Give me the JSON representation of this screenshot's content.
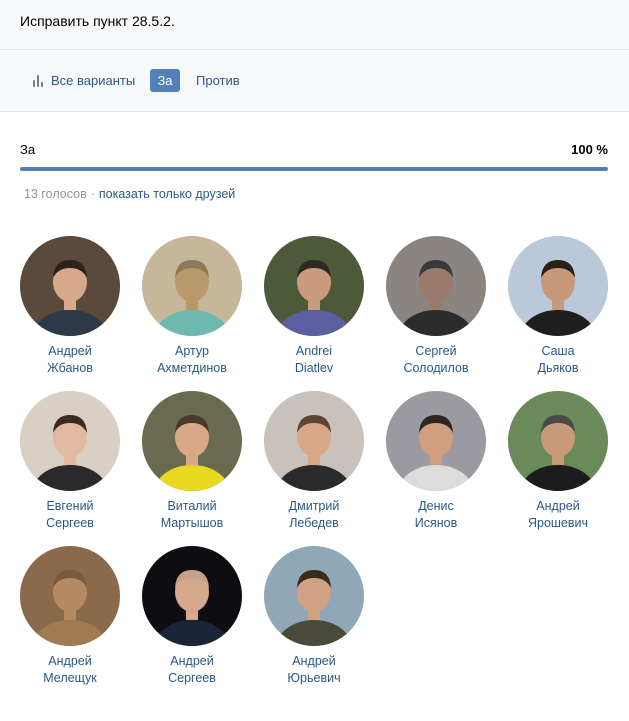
{
  "header": {
    "title": "Исправить пункт 28.5.2."
  },
  "tabs": {
    "all_label": "Все варианты",
    "for_label": "За",
    "against_label": "Против"
  },
  "result": {
    "label": "За",
    "percent_text": "100 %",
    "percent": 100
  },
  "meta": {
    "votes_count": "13 голосов",
    "separator": "·",
    "friends_link": "показать только друзей"
  },
  "colors": {
    "accent": "#5181b8",
    "link": "#2a5885",
    "muted": "#939393"
  },
  "voters": [
    {
      "first": "Андрей",
      "last": "Жбанов",
      "avatar_bg": "#5a4a3c",
      "skin": "#d8a88a",
      "cloth": "#2d3a4a",
      "hair": "#2b221c"
    },
    {
      "first": "Артур",
      "last": "Ахметдинов",
      "avatar_bg": "#c7b79a",
      "skin": "#b89a6a",
      "cloth": "#6fb8b0",
      "hair": "#8a7a5a"
    },
    {
      "first": "Andrei",
      "last": "Diatlev",
      "avatar_bg": "#4d5a3a",
      "skin": "#c99a7c",
      "cloth": "#5a5fa0",
      "hair": "#2e2a22"
    },
    {
      "first": "Сергей",
      "last": "Солодилов",
      "avatar_bg": "#8a8580",
      "skin": "#9a7a6a",
      "cloth": "#2c2c2c",
      "hair": "#3a3a3a"
    },
    {
      "first": "Саша",
      "last": "Дьяков",
      "avatar_bg": "#b9c9d9",
      "skin": "#c7987a",
      "cloth": "#1e1e1e",
      "hair": "#2a2018"
    },
    {
      "first": "Евгений",
      "last": "Сергеев",
      "avatar_bg": "#d9cfc2",
      "skin": "#e0b9a0",
      "cloth": "#2a2a2a",
      "hair": "#3a2a20"
    },
    {
      "first": "Виталий",
      "last": "Мартышов",
      "avatar_bg": "#6a6a50",
      "skin": "#d9a889",
      "cloth": "#e8d820",
      "hair": "#4a3a2a"
    },
    {
      "first": "Дмитрий",
      "last": "Лебедев",
      "avatar_bg": "#c9c2bc",
      "skin": "#d8a788",
      "cloth": "#2a2a2a",
      "hair": "#5a4432"
    },
    {
      "first": "Денис",
      "last": "Исянов",
      "avatar_bg": "#9a9aa0",
      "skin": "#d19e80",
      "cloth": "#dcdcdc",
      "hair": "#2e2620"
    },
    {
      "first": "Андрей",
      "last": "Ярошевич",
      "avatar_bg": "#6a8a5a",
      "skin": "#c99a7a",
      "cloth": "#1c1c1c",
      "hair": "#4a4a4a"
    },
    {
      "first": "Андрей",
      "last": "Мелещук",
      "avatar_bg": "#8a6a4a",
      "skin": "#b58a62",
      "cloth": "#a07a52",
      "hair": "#7a5a3a"
    },
    {
      "first": "Андрей",
      "last": "Сергеев",
      "avatar_bg": "#0e0e12",
      "skin": "#d6a98c",
      "cloth": "#1a2436",
      "hair": "#c7a088"
    },
    {
      "first": "Андрей",
      "last": "Юрьевич",
      "avatar_bg": "#8fa7b7",
      "skin": "#d1a184",
      "cloth": "#4a4a3a",
      "hair": "#3a2a20"
    }
  ]
}
